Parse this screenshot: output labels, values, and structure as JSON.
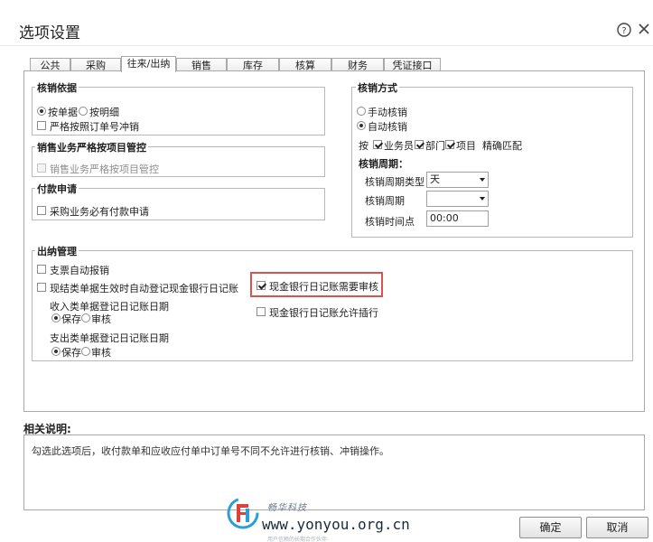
{
  "dialog": {
    "title": "选项设置"
  },
  "tabs": [
    "公共",
    "采购",
    "往来/出纳",
    "销售",
    "库存",
    "核算",
    "财务",
    "凭证接口"
  ],
  "active_tab": "往来/出纳",
  "basis": {
    "title": "核销依据",
    "radio_doc": "按单据",
    "radio_detail": "按明细",
    "strict_order": "严格按照订单号冲销"
  },
  "sales_control": {
    "title": "销售业务严格按项目管控",
    "checkbox": "销售业务严格按项目管控"
  },
  "payment_req": {
    "title": "付款申请",
    "checkbox": "采购业务必有付款申请"
  },
  "method": {
    "title": "核销方式",
    "manual": "手动核销",
    "auto": "自动核销",
    "by_prefix": "按",
    "salesman": "业务员",
    "dept": "部门",
    "project": "项目",
    "exact": "精确匹配",
    "period_title": "核销周期：",
    "period_type_label": "核销周期类型",
    "period_type_value": "天",
    "period_label": "核销周期",
    "period_value": "",
    "time_label": "核销时间点",
    "time_value": "00:00"
  },
  "cash": {
    "title": "出纳管理",
    "check_auto": "支票自动报销",
    "auto_register": "现结类单据生效时自动登记现金银行日记账",
    "income_label": "收入类单据登记日记账日期",
    "expense_label": "支出类单据登记日记账日期",
    "save": "保存",
    "review": "审核",
    "need_review": "现金银行日记账需要审核",
    "allow_insert": "现金银行日记账允许插行"
  },
  "description": {
    "title": "相关说明:",
    "text": "勾选此选项后，收付款单和应收应付单中订单号不同不允许进行核销、冲销操作。"
  },
  "buttons": {
    "ok": "确定",
    "cancel": "取消"
  },
  "watermark": {
    "brand": "畅华科技",
    "url": "www.yonyou.org.cn",
    "tagline": "用户信赖的长期合作伙伴"
  },
  "colors": {
    "highlight": "#d9534f",
    "logo_blue": "#2a9fd6",
    "logo_red": "#e0403a"
  }
}
